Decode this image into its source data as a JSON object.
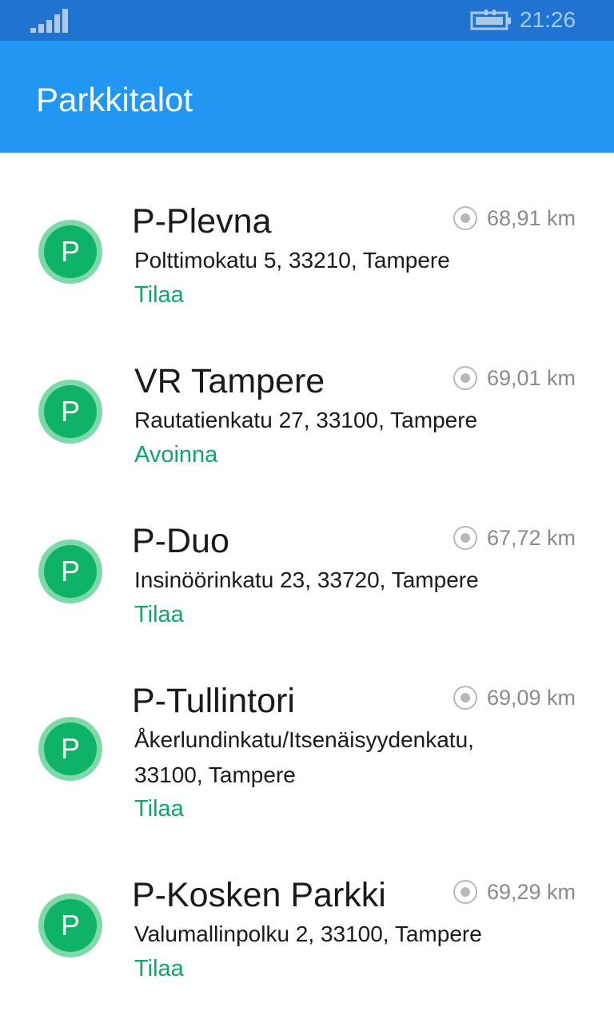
{
  "status_bar": {
    "time": "21:26",
    "signal_icon": "signal-icon",
    "battery_icon": "battery-charging-icon"
  },
  "header": {
    "title": "Parkkitalot"
  },
  "colors": {
    "status_bar": "#1e74d0",
    "header": "#2196f3",
    "accent_green": "#0fb367",
    "status_text": "#0aa86a"
  },
  "parking": [
    {
      "avatar_letter": "P",
      "name": "P-Plevna",
      "address": "Polttimokatu 5, 33210, Tampere",
      "status": "Tilaa",
      "distance": "68,91 km"
    },
    {
      "avatar_letter": "P",
      "name": "VR Tampere",
      "address": "Rautatienkatu 27, 33100, Tampere",
      "status": "Avoinna",
      "distance": "69,01 km"
    },
    {
      "avatar_letter": "P",
      "name": "P-Duo",
      "address": "Insinöörinkatu 23, 33720, Tampere",
      "status": "Tilaa",
      "distance": "67,72 km"
    },
    {
      "avatar_letter": "P",
      "name": "P-Tullintori",
      "address": "Åkerlundinkatu/Itsenäisyydenkatu, 33100, Tampere",
      "status": "Tilaa",
      "distance": "69,09 km"
    },
    {
      "avatar_letter": "P",
      "name": "P-Kosken Parkki",
      "address": "Valumallinpolku 2, 33100, Tampere",
      "status": "Tilaa",
      "distance": "69,29 km"
    }
  ]
}
